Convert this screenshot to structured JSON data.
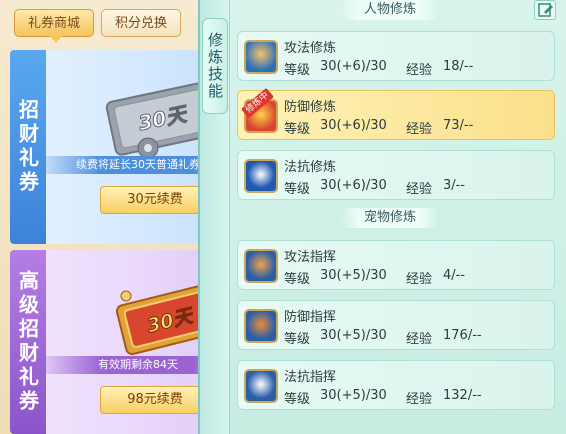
{
  "shop": {
    "tabs": [
      {
        "label": "礼券商城",
        "active": true
      },
      {
        "label": "积分兑换",
        "active": false
      }
    ],
    "cards": [
      {
        "side_label": "招财礼券",
        "ticket_text": "30天",
        "note": "续费将延长30天普通礼券",
        "button": "30元续费"
      },
      {
        "side_label": "高级招财礼券",
        "ticket_text": "30天",
        "note": "有效期剩余84天",
        "button": "98元续费"
      }
    ]
  },
  "cultivation": {
    "side_tab": "修炼技能",
    "character_title": "人物修炼",
    "pet_title": "宠物修炼",
    "level_label": "等级",
    "exp_label": "经验",
    "badge_text": "修炼中",
    "character_rows": [
      {
        "name": "攻法修炼",
        "level": "30(+6)/30",
        "exp": "18/--",
        "icon": "monk-icon",
        "active": false
      },
      {
        "name": "防御修炼",
        "level": "30(+6)/30",
        "exp": "73/--",
        "icon": "shield-icon",
        "active": true
      },
      {
        "name": "法抗修炼",
        "level": "30(+6)/30",
        "exp": "3/--",
        "icon": "yinyang-shield-icon",
        "active": false
      }
    ],
    "pet_rows": [
      {
        "name": "攻法指挥",
        "level": "30(+5)/30",
        "exp": "4/--",
        "icon": "paw-attack-icon",
        "active": false
      },
      {
        "name": "防御指挥",
        "level": "30(+5)/30",
        "exp": "176/--",
        "icon": "paw-shield-icon",
        "active": false
      },
      {
        "name": "法抗指挥",
        "level": "30(+5)/30",
        "exp": "132/--",
        "icon": "paw-resist-icon",
        "active": false
      }
    ]
  },
  "colors": {
    "accent_gold": "#f6c45d",
    "panel_teal": "#c6ece2",
    "active_row": "#fbe08a"
  }
}
